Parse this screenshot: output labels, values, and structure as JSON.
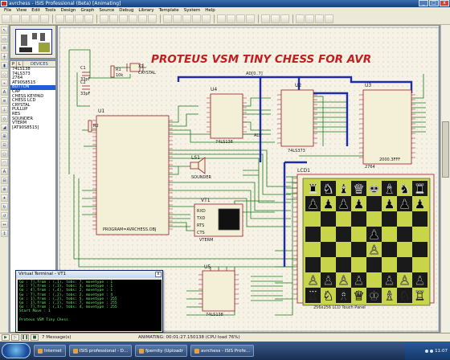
{
  "window": {
    "title": "avrchess - ISIS Professional (Beta) [Animating]",
    "buttons": [
      "_",
      "□",
      "x"
    ]
  },
  "menu": [
    "File",
    "View",
    "Edit",
    "Tools",
    "Design",
    "Graph",
    "Source",
    "Debug",
    "Library",
    "Template",
    "System",
    "Help"
  ],
  "device_panel": {
    "tab_p": "P",
    "tab_l": "L",
    "header": "DEVICES",
    "items": [
      "74LS138",
      "74LS373",
      "2764",
      "AT90S8515",
      "BUTTON",
      "CAP",
      "CHESS KEYPAD",
      "CHESS LCD",
      "CRYSTAL",
      "PULLUP",
      "RES",
      "SOUNDER",
      "VTERM",
      "[AT90S8515]"
    ],
    "selected_index": 4
  },
  "schematic": {
    "title": "PROTEUS VSM TINY CHESS FOR AVR",
    "labels": {
      "u1": "U1",
      "u1_part": "PROGRAM=AVRCHESS.OBJ",
      "u2": "U2",
      "u2_part": "74LS373",
      "u3": "U3",
      "u3_part": "2000.3FFF",
      "u3_part2": "2764",
      "u4": "U4",
      "u4_part": "74LS138",
      "u5": "U5",
      "u5_part": "74LS138",
      "lcd": "LCD1",
      "lcd_part": "256x256 LCD Touch Panel",
      "ls1": "LS1",
      "ls1_part": "SOUNDER",
      "vt1": "VT1",
      "vt1_part": "VTERM",
      "vt1_rxd": "RXD",
      "vt1_txd": "TXD",
      "vt1_rts": "RTS",
      "vt1_cts": "CTS",
      "c1": "C1",
      "c1_val": "33pF",
      "c2": "C2",
      "c2_val": "33pF",
      "r1": "R1",
      "r1_val": "10k",
      "r2": "R2",
      "x1": "X1",
      "x1_val": "CRYSTAL",
      "ale": "ALE",
      "bus": "AD[0..7]"
    }
  },
  "virtual_terminal": {
    "title": "Virtual Terminal - VT1",
    "close": "x",
    "lines": [
      "Go  : 7],from : (,1),  tobs: 7, movetype : 1",
      "Go  : 7],from : (,3),  tobs: 3, movetype : 1",
      "Go  : 4],from : (,4),  tobs: 2, movetype : 1",
      "Go  : 7],from : (,2),  tobs: 2, movetype : 4",
      "Go  : 1],from : (,2),  tobs: 5, movetype : 255",
      "Go  : 1],from : (,2),  tobs: 7, movetype : 255",
      "Go  : 7],from : (,1),  tobs: 4, movetype : 255",
      "Start Move : 1",
      "",
      "Proteus VSM Tiny Chess"
    ]
  },
  "status": {
    "messages": "7 Message(s)",
    "animating": "ANIMATING: 00:01:27.150138 (CPU load 76%)"
  },
  "taskbar": {
    "items": [
      "Internet",
      "ISIS professional - D...",
      "fpernity (Uploadr",
      "avrchess - ISIS Profe..."
    ],
    "clock": "11:07"
  },
  "colors": {
    "canvas": "#f6f2e6",
    "wire": "#1a7a1a",
    "bus": "#1c2caa",
    "component": "#9a1a2a",
    "chip_fill": "#f4f0d8",
    "title_red": "#c02020",
    "lcd_light": "#c8d44a",
    "lcd_dark": "#1a1a1a"
  },
  "chess_board": {
    "rows": [
      [
        "r",
        "n",
        "b",
        "q",
        "k",
        "b",
        "n",
        "r"
      ],
      [
        "p",
        "p",
        "p",
        "p",
        "",
        "p",
        "p",
        "p"
      ],
      [
        "",
        "",
        "",
        "",
        "",
        "",
        "",
        ""
      ],
      [
        "",
        "",
        "",
        "",
        "p",
        "",
        "",
        ""
      ],
      [
        "",
        "",
        "",
        "",
        "P",
        "",
        "",
        ""
      ],
      [
        "",
        "",
        "",
        "",
        "",
        "",
        "",
        ""
      ],
      [
        "P",
        "P",
        "P",
        "P",
        "",
        "P",
        "P",
        "P"
      ],
      [
        "R",
        "N",
        "B",
        "Q",
        "K",
        "B",
        "N",
        "R"
      ]
    ]
  }
}
